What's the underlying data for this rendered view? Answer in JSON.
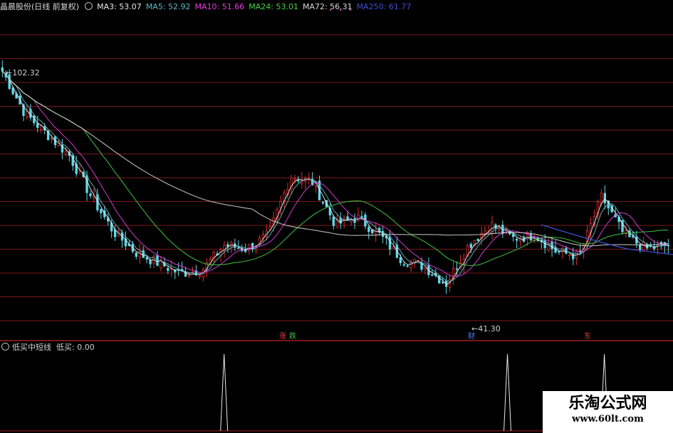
{
  "window": {
    "title": "晶晨股份(日线 前复权)",
    "indicators": [
      {
        "label": "MA3: 53.07",
        "color": "#e8e8e8"
      },
      {
        "label": "MA5: 52.92",
        "color": "#5fb8c8"
      },
      {
        "label": "MA10: 51.66",
        "color": "#e040e0"
      },
      {
        "label": "MA24: 53.01",
        "color": "#44d244"
      },
      {
        "label": "MA72: 56.31",
        "color": "#d8d8d8"
      },
      {
        "label": "MA250: 61.77",
        "color": "#3f4fd0"
      }
    ]
  },
  "price_labels": {
    "high": "102.32",
    "low": "41.30"
  },
  "markers": [
    {
      "text": "涨",
      "color": "#e04040"
    },
    {
      "text": "跌",
      "color": "#40c040"
    },
    {
      "text": "财",
      "color": "#4f80ff"
    },
    {
      "text": "东",
      "color": "#e04040"
    }
  ],
  "sub_panel": {
    "name": "低买中短线",
    "value_label": "低买: 0.00"
  },
  "watermark": {
    "line1": "乐淘公式网",
    "line2": "www.60lt.com"
  },
  "colors": {
    "up": "#e03030",
    "down": "#5fd8e8",
    "grid": "#7a1a1a",
    "separator": "#a02020"
  },
  "chart_data": [
    {
      "type": "line",
      "title": "晶晨股份(日线 前复权)",
      "series": [
        {
          "name": "MA3",
          "value": 53.07
        },
        {
          "name": "MA5",
          "value": 52.92
        },
        {
          "name": "MA10",
          "value": 51.66
        },
        {
          "name": "MA24",
          "value": 53.01
        },
        {
          "name": "MA72",
          "value": 56.31
        },
        {
          "name": "MA250",
          "value": 61.77
        }
      ],
      "annotations": [
        "102.32",
        "41.30"
      ],
      "approx_close_trend": [
        102,
        90,
        84,
        78,
        66,
        56,
        50,
        47,
        44,
        45,
        52,
        51,
        55,
        72,
        70,
        58,
        60,
        55,
        48,
        46,
        41,
        52,
        58,
        54,
        55,
        50,
        49,
        66,
        55,
        51,
        52
      ]
    },
    {
      "type": "line",
      "title": "低买中短线",
      "series": [
        {
          "name": "低买",
          "value": 0.0
        }
      ],
      "spikes_at_fraction": [
        0.333,
        0.754,
        0.898
      ]
    }
  ]
}
